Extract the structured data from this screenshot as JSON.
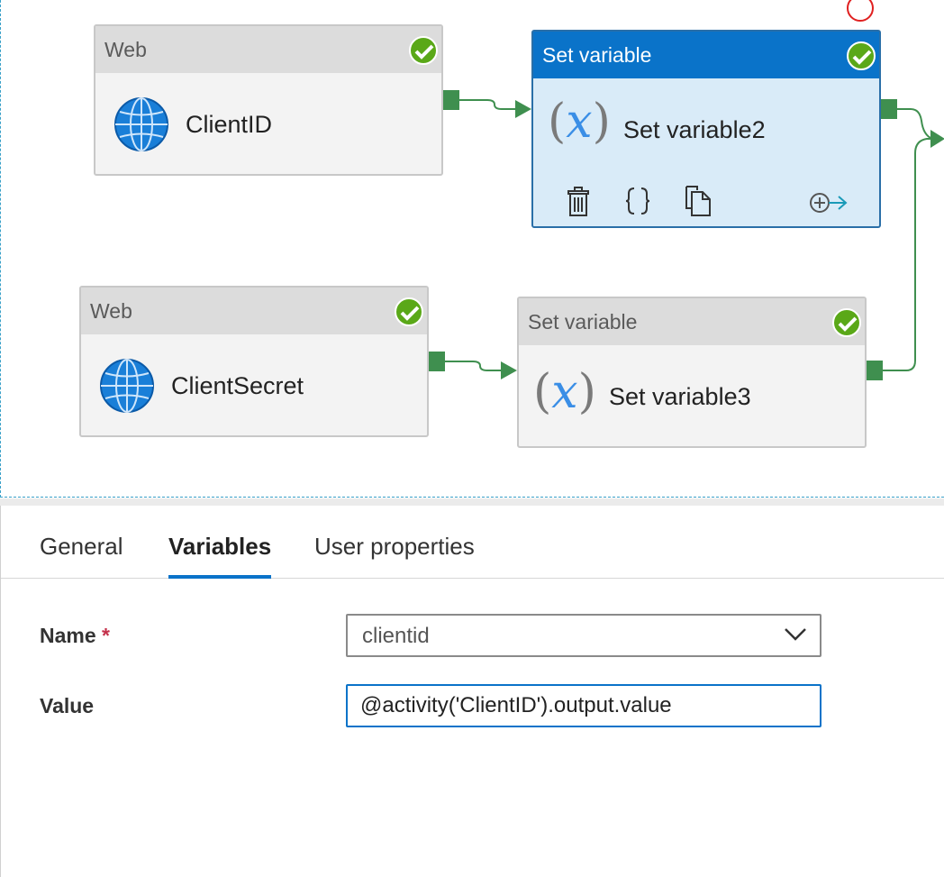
{
  "pipeline": {
    "nodes": {
      "web1": {
        "type_label": "Web",
        "name": "ClientID",
        "status": "succeeded"
      },
      "set2": {
        "type_label": "Set variable",
        "name": "Set variable2",
        "status": "succeeded",
        "selected": true
      },
      "web2": {
        "type_label": "Web",
        "name": "ClientSecret",
        "status": "succeeded"
      },
      "set3": {
        "type_label": "Set variable",
        "name": "Set variable3",
        "status": "succeeded"
      }
    },
    "fx_symbol": "x",
    "toolbar_icons": [
      "delete-icon",
      "code-icon",
      "copy-icon",
      "add-output-icon"
    ]
  },
  "panel": {
    "tabs": [
      {
        "label": "General"
      },
      {
        "label": "Variables",
        "active": true
      },
      {
        "label": "User properties"
      }
    ],
    "fields": {
      "name_label": "Name",
      "name_required": "*",
      "name_value": "clientid",
      "value_label": "Value",
      "value_value": "@activity('ClientID').output.value"
    }
  },
  "colors": {
    "accent": "#0a73c9",
    "success": "#5aa818",
    "port": "#3f8f4f",
    "selected_bg": "#d9ebf8"
  }
}
